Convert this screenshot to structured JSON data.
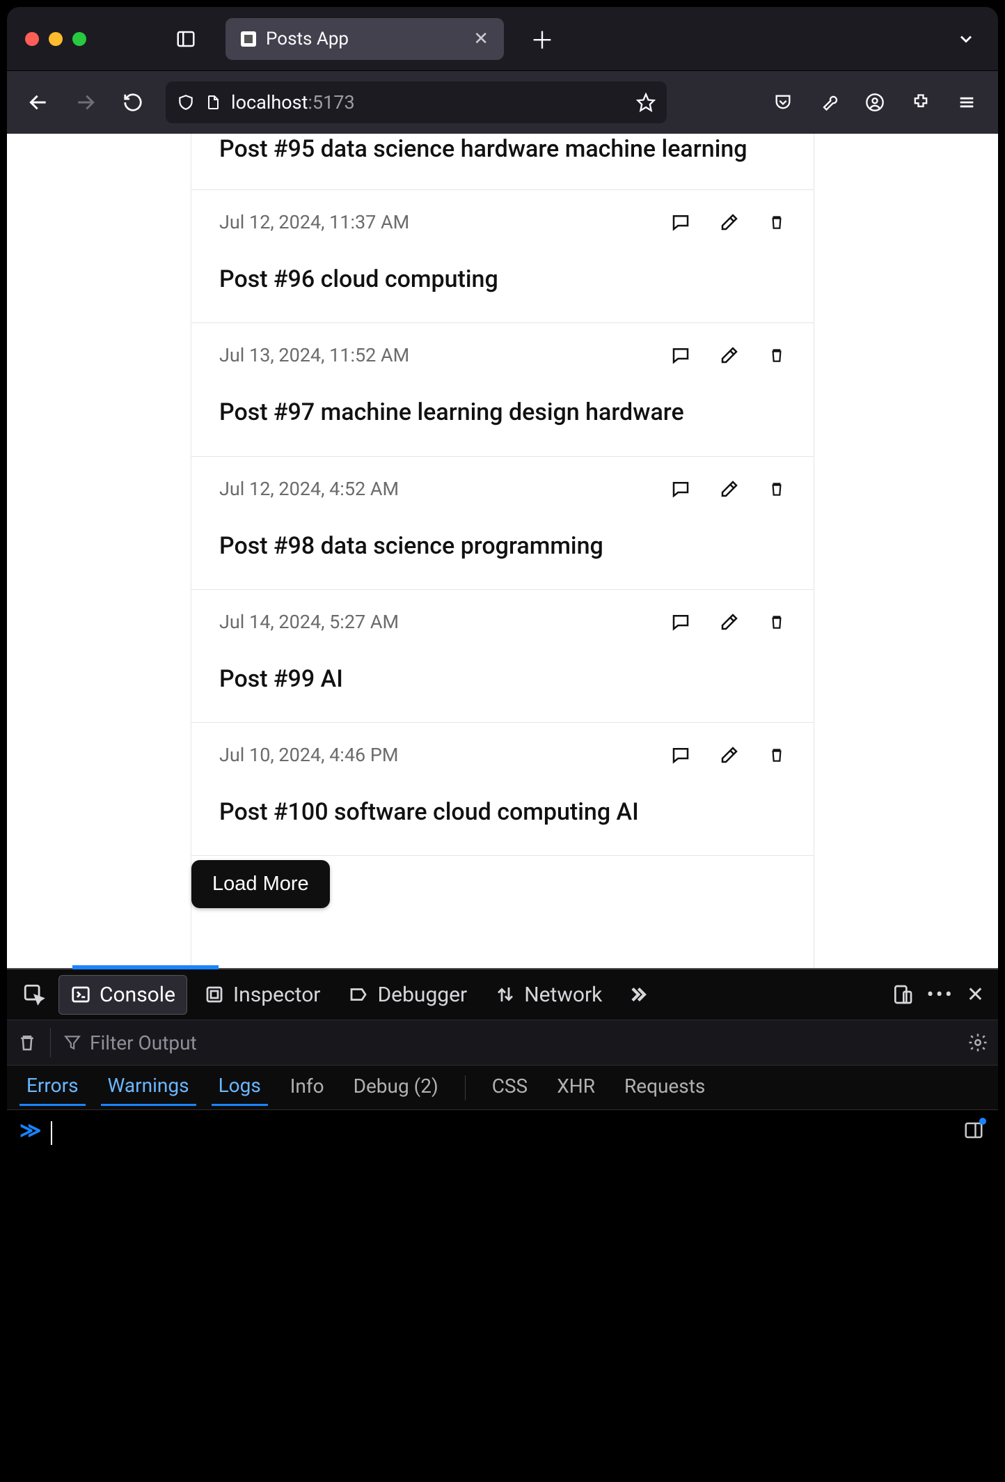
{
  "browser": {
    "tab_title": "Posts App",
    "url_host": "localhost",
    "url_port": ":5173"
  },
  "feed": {
    "load_more": "Load More",
    "posts": [
      {
        "date": "",
        "title": "Post #95 data science hardware machine learning"
      },
      {
        "date": "Jul 12, 2024, 11:37 AM",
        "title": "Post #96 cloud computing"
      },
      {
        "date": "Jul 13, 2024, 11:52 AM",
        "title": "Post #97 machine learning design hardware"
      },
      {
        "date": "Jul 12, 2024, 4:52 AM",
        "title": "Post #98 data science programming"
      },
      {
        "date": "Jul 14, 2024, 5:27 AM",
        "title": "Post #99 AI"
      },
      {
        "date": "Jul 10, 2024, 4:46 PM",
        "title": "Post #100 software cloud computing AI"
      }
    ]
  },
  "devtools": {
    "tabs": {
      "console": "Console",
      "inspector": "Inspector",
      "debugger": "Debugger",
      "network": "Network"
    },
    "filter_placeholder": "Filter Output",
    "chips": {
      "errors": "Errors",
      "warnings": "Warnings",
      "logs": "Logs",
      "info": "Info",
      "debug": "Debug (2)",
      "css": "CSS",
      "xhr": "XHR",
      "requests": "Requests"
    }
  }
}
